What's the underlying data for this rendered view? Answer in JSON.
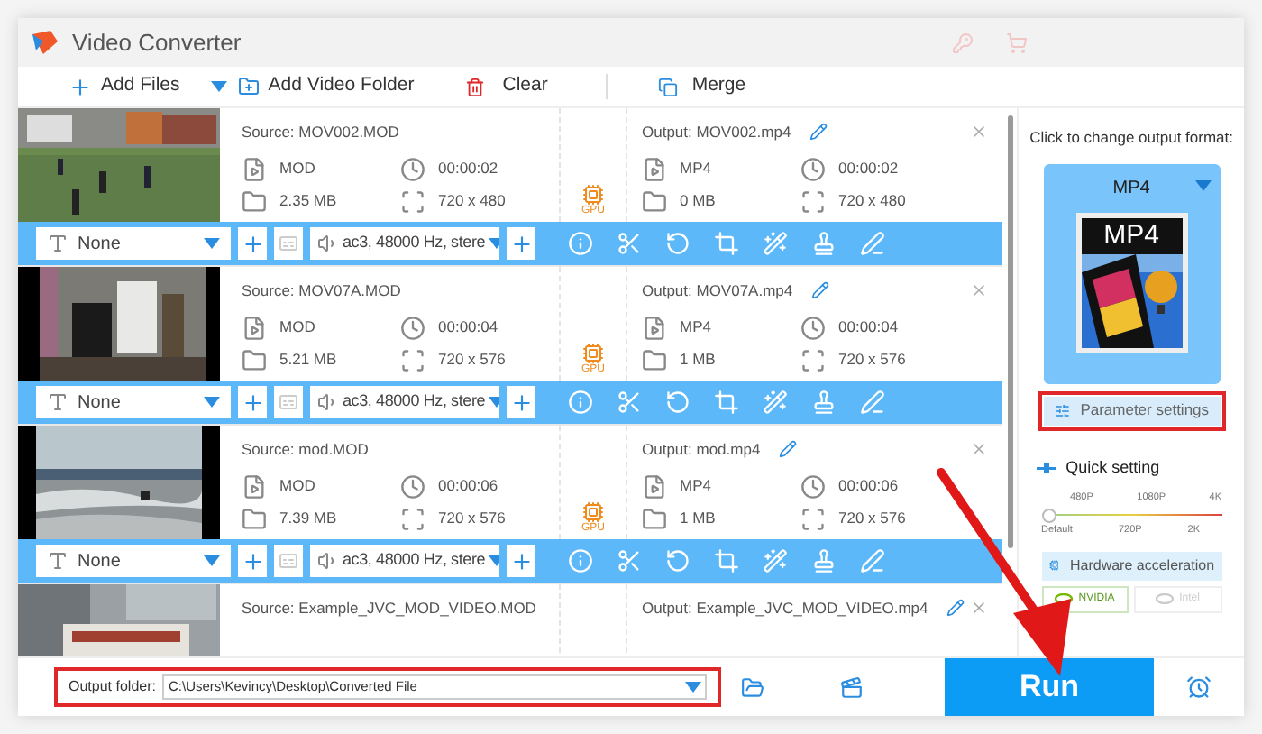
{
  "window": {
    "title": "Video Converter"
  },
  "toolbar": [
    {
      "kind": "add",
      "label": "Add Files"
    },
    {
      "kind": "dropdown"
    },
    {
      "kind": "folder",
      "label": "Add Video Folder"
    },
    {
      "kind": "clear",
      "label": "Clear"
    },
    {
      "kind": "merge",
      "label": "Merge"
    }
  ],
  "items": [
    {
      "source": "Source: MOV002.MOD",
      "output": "Output: MOV002.mp4",
      "src_format": "MOD",
      "src_duration": "00:00:02",
      "src_size": "2.35 MB",
      "src_resolution": "720 x 480",
      "out_format": "MP4",
      "out_duration": "00:00:02",
      "out_size": "0 MB",
      "out_resolution": "720 x 480",
      "gpu": "GPU",
      "subtitle": "None",
      "audio": "ac3, 48000 Hz, stere"
    },
    {
      "source": "Source: MOV07A.MOD",
      "output": "Output: MOV07A.mp4",
      "src_format": "MOD",
      "src_duration": "00:00:04",
      "src_size": "5.21 MB",
      "src_resolution": "720 x 576",
      "out_format": "MP4",
      "out_duration": "00:00:04",
      "out_size": "1 MB",
      "out_resolution": "720 x 576",
      "gpu": "GPU",
      "subtitle": "None",
      "audio": "ac3, 48000 Hz, stere"
    },
    {
      "source": "Source: mod.MOD",
      "output": "Output: mod.mp4",
      "src_format": "MOD",
      "src_duration": "00:00:06",
      "src_size": "7.39 MB",
      "src_resolution": "720 x 576",
      "out_format": "MP4",
      "out_duration": "00:00:06",
      "out_size": "1 MB",
      "out_resolution": "720 x 576",
      "gpu": "GPU",
      "subtitle": "None",
      "audio": "ac3, 48000 Hz, stere"
    },
    {
      "source": "Source: Example_JVC_MOD_VIDEO.MOD",
      "output": "Output: Example_JVC_MOD_VIDEO.mp4"
    }
  ],
  "output_format": {
    "hint": "Click to change output format:",
    "format": "MP4",
    "badge": "MP4"
  },
  "parameter_settings": "Parameter settings",
  "quick_setting": {
    "label": "Quick setting",
    "top_ticks": [
      "480P",
      "1080P",
      "4K"
    ],
    "bottom_ticks": [
      "Default",
      "720P",
      "2K"
    ],
    "level": 0
  },
  "hardware_acceleration": {
    "label": "Hardware acceleration",
    "options": [
      {
        "label": "NVIDIA",
        "selected": true
      },
      {
        "label": "Intel",
        "selected": false
      }
    ]
  },
  "output_folder": {
    "label": "Output folder:",
    "value": "C:\\Users\\Kevincy\\Desktop\\Converted File"
  },
  "run": "Run"
}
